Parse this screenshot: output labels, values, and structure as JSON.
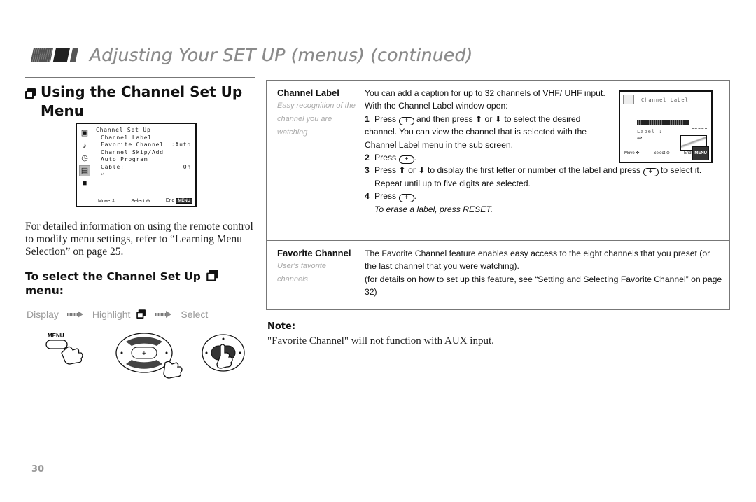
{
  "header": {
    "title": "Adjusting Your SET UP (menus) (continued)"
  },
  "left": {
    "section_title": "Using the Channel Set Up Menu",
    "section_icon": "channel-setup-menu-icon",
    "osd": {
      "title": "Channel Set Up",
      "side_icons": [
        "picture-icon",
        "sound-icon",
        "timer-icon",
        "channel-setup-icon",
        "video-input-icon"
      ],
      "items": [
        {
          "label": "Channel Label",
          "value": ""
        },
        {
          "label": "Favorite Channel",
          "value": ":Auto"
        },
        {
          "label": "Channel Skip/Add",
          "value": ""
        },
        {
          "label": "Auto Program",
          "value": ""
        },
        {
          "label": "Cable:",
          "value": "On"
        }
      ],
      "return_symbol": "↩",
      "footer": {
        "move": "Move ⇕",
        "select": "Select ⊕",
        "end": "End",
        "menu_key": "MENU"
      }
    },
    "paragraph": "For detailed information on using the remote control to modify menu settings, refer to “Learning Menu Selection” on page 25.",
    "sub_title": "To select the Channel Set Up",
    "sub_title_tail": "menu:",
    "steps": [
      "Display",
      "Highlight",
      "Select"
    ],
    "menu_button_label": "MENU"
  },
  "table": {
    "rows": [
      {
        "label": "Channel Label",
        "description": "Easy recognition of the channel you are watching",
        "intro": [
          "You can add a caption for up to 32 channels of VHF/ UHF input.",
          "With the Channel Label window open:"
        ],
        "steps": [
          {
            "num": "1",
            "pre": "Press",
            "mid": "and then press ⬆ or ⬇ to select the desired channel. You can view the channel that is selected with the Channel Label menu in the sub screen."
          },
          {
            "num": "2",
            "pre": "Press",
            "mid": "."
          },
          {
            "num": "3",
            "pre": "Press ⬆ or ⬇ to display the first letter or number of the label and press",
            "mid": "to select it."
          },
          {
            "num": "",
            "pre": "Repeat until up to five digits are selected.",
            "mid": ""
          },
          {
            "num": "4",
            "pre": "Press",
            "mid": "."
          }
        ],
        "tip": "To erase a label, press RESET.",
        "sub_screen": {
          "title": "Channel Label",
          "label_text": "Label :",
          "footer": {
            "move": "Move ✥",
            "select": "Select ⊕",
            "end": "End",
            "menu_key": "MENU"
          }
        }
      },
      {
        "label": "Favorite Channel",
        "description": "User's favorite channels",
        "text": "The Favorite Channel feature enables easy access to the eight channels that you preset (or the last channel that you were watching).",
        "text2": "(for details on how to set up this feature, see “Setting and Selecting Favorite Channel” on page 32)"
      }
    ]
  },
  "note": {
    "heading": "Note:",
    "text": "\"Favorite Channel\" will not function with AUX input."
  },
  "page_number": "30",
  "joystick_symbol": "+"
}
